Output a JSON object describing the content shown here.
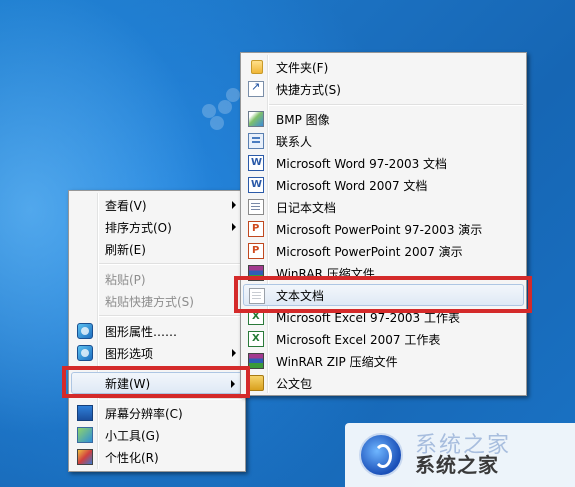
{
  "context_menu": {
    "items": [
      {
        "label": "查看(V)",
        "has_submenu": true
      },
      {
        "label": "排序方式(O)",
        "has_submenu": true
      },
      {
        "label": "刷新(E)"
      },
      {
        "label": "粘贴(P)",
        "disabled": true
      },
      {
        "label": "粘贴快捷方式(S)",
        "disabled": true
      },
      {
        "label": "图形属性……",
        "icon": "graphics-properties-icon"
      },
      {
        "label": "图形选项",
        "icon": "graphics-options-icon",
        "has_submenu": true
      },
      {
        "label": "新建(W)",
        "has_submenu": true,
        "highlighted": true
      },
      {
        "label": "屏幕分辨率(C)",
        "icon": "screen-resolution-icon"
      },
      {
        "label": "小工具(G)",
        "icon": "gadgets-icon"
      },
      {
        "label": "个性化(R)",
        "icon": "personalize-icon"
      }
    ]
  },
  "new_submenu": {
    "items": [
      {
        "label": "文件夹(F)",
        "icon": "folder-icon"
      },
      {
        "label": "快捷方式(S)",
        "icon": "shortcut-icon"
      },
      {
        "label": "BMP 图像",
        "icon": "bmp-image-icon"
      },
      {
        "label": "联系人",
        "icon": "contact-icon"
      },
      {
        "label": "Microsoft Word 97-2003 文档",
        "icon": "word-document-icon"
      },
      {
        "label": "Microsoft Word 2007 文档",
        "icon": "word-document-icon"
      },
      {
        "label": "日记本文档",
        "icon": "journal-document-icon"
      },
      {
        "label": "Microsoft PowerPoint 97-2003 演示",
        "icon": "powerpoint-icon"
      },
      {
        "label": "Microsoft PowerPoint 2007 演示",
        "icon": "powerpoint-icon"
      },
      {
        "label": "WinRAR 压缩文件",
        "icon": "winrar-icon"
      },
      {
        "label": "文本文档",
        "icon": "text-document-icon",
        "highlighted": true
      },
      {
        "label": "Microsoft Excel 97-2003 工作表",
        "icon": "excel-icon"
      },
      {
        "label": "Microsoft Excel 2007 工作表",
        "icon": "excel-icon"
      },
      {
        "label": "WinRAR ZIP 压缩文件",
        "icon": "winrar-zip-icon"
      },
      {
        "label": "公文包",
        "icon": "briefcase-icon"
      }
    ]
  },
  "watermark": {
    "text": "系统之家",
    "faded_text": "系统之家"
  },
  "colors": {
    "annotation_red": "#d42a2a",
    "desktop_blue": "#1b70c0",
    "menu_bg": "#f5f5f5"
  }
}
